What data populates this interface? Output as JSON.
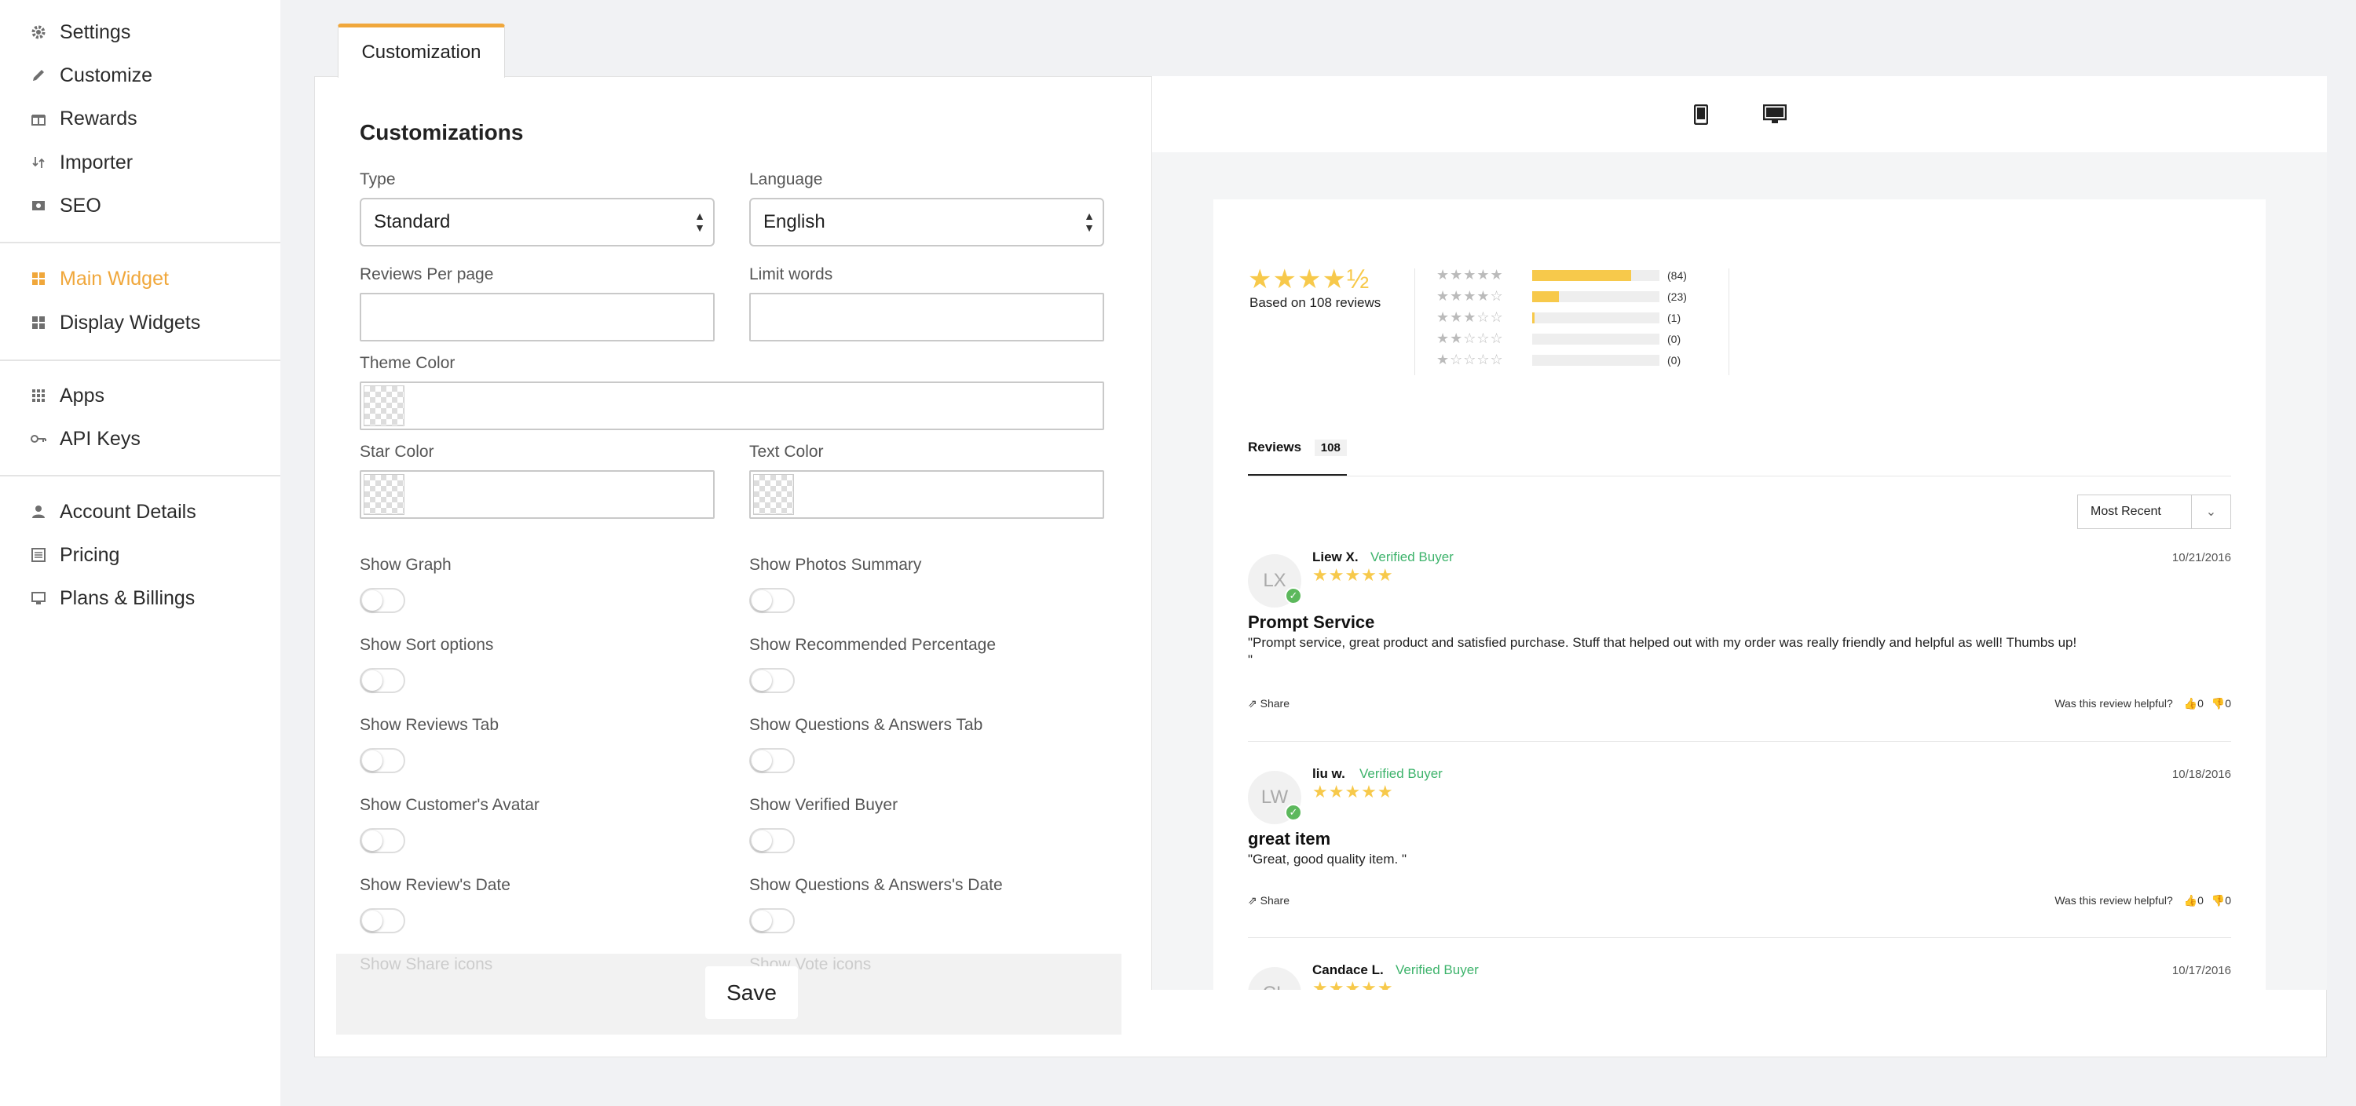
{
  "sidebar": {
    "items": [
      {
        "label": "Settings",
        "icon": "gear-icon"
      },
      {
        "label": "Customize",
        "icon": "pencil-icon"
      },
      {
        "label": "Rewards",
        "icon": "gift-icon"
      },
      {
        "label": "Importer",
        "icon": "import-icon"
      },
      {
        "label": "SEO",
        "icon": "seo-icon"
      },
      {
        "label": "Main Widget",
        "icon": "grid-icon",
        "active": true
      },
      {
        "label": "Display Widgets",
        "icon": "widgets-icon"
      },
      {
        "label": "Apps",
        "icon": "apps-icon"
      },
      {
        "label": "API Keys",
        "icon": "key-icon"
      },
      {
        "label": "Account Details",
        "icon": "person-icon"
      },
      {
        "label": "Pricing",
        "icon": "list-icon"
      },
      {
        "label": "Plans & Billings",
        "icon": "monitor-icon"
      }
    ],
    "active_color": "#f0a73b"
  },
  "tab": {
    "label": "Customization"
  },
  "form": {
    "title": "Customizations",
    "type": {
      "label": "Type",
      "value": "Standard"
    },
    "language": {
      "label": "Language",
      "value": "English"
    },
    "reviews_per_page": {
      "label": "Reviews Per page",
      "value": ""
    },
    "limit_words": {
      "label": "Limit words",
      "value": ""
    },
    "theme_color": {
      "label": "Theme Color"
    },
    "star_color": {
      "label": "Star Color"
    },
    "text_color": {
      "label": "Text Color"
    },
    "toggles": [
      {
        "label": "Show Graph",
        "on": false
      },
      {
        "label": "Show Photos Summary",
        "on": false
      },
      {
        "label": "Show Sort options",
        "on": false
      },
      {
        "label": "Show Recommended Percentage",
        "on": false
      },
      {
        "label": "Show Reviews Tab",
        "on": false
      },
      {
        "label": "Show Questions & Answers Tab",
        "on": false
      },
      {
        "label": "Show Customer's Avatar",
        "on": false
      },
      {
        "label": "Show Verified Buyer",
        "on": false
      },
      {
        "label": "Show Review's Date",
        "on": false
      },
      {
        "label": "Show Questions & Answers's Date",
        "on": false
      },
      {
        "label": "Show Share icons",
        "on": false
      },
      {
        "label": "Show Vote icons",
        "on": false
      }
    ],
    "save_label": "Save"
  },
  "preview": {
    "devices": [
      "mobile-icon",
      "desktop-icon"
    ],
    "summary": {
      "stars": "★★★★½",
      "based_on": "Based on 108 reviews"
    },
    "breakdown": [
      {
        "stars": "★★★★★",
        "fraction": 0.78,
        "count": "(84)"
      },
      {
        "stars": "★★★★☆",
        "fraction": 0.21,
        "count": "(23)"
      },
      {
        "stars": "★★★☆☆",
        "fraction": 0.02,
        "count": "(1)"
      },
      {
        "stars": "★★☆☆☆",
        "fraction": 0,
        "count": "(0)"
      },
      {
        "stars": "★☆☆☆☆",
        "fraction": 0,
        "count": "(0)"
      }
    ],
    "reviews_tab": {
      "label": "Reviews",
      "count": "108"
    },
    "sort": {
      "value": "Most Recent"
    },
    "helpful_label": "Was this review helpful?",
    "share_label": "Share",
    "reviews": [
      {
        "initials": "LX",
        "name": "Liew X.",
        "verified": "Verified Buyer",
        "stars": "★★★★★",
        "date": "10/21/2016",
        "title": "Prompt Service",
        "text": "\"Prompt service, great product and satisfied purchase. Stuff that helped out with my order was really friendly and helpful as well! Thumbs up!\n\"",
        "up": "0",
        "down": "0"
      },
      {
        "initials": "LW",
        "name": "liu w.",
        "verified": "Verified Buyer",
        "stars": "★★★★★",
        "date": "10/18/2016",
        "title": "great item",
        "text": "\"Great, good quality item. \"",
        "up": "0",
        "down": "0"
      },
      {
        "initials": "CL",
        "name": "Candace L.",
        "verified": "Verified Buyer",
        "stars": "★★★★★",
        "date": "10/17/2016"
      }
    ]
  }
}
